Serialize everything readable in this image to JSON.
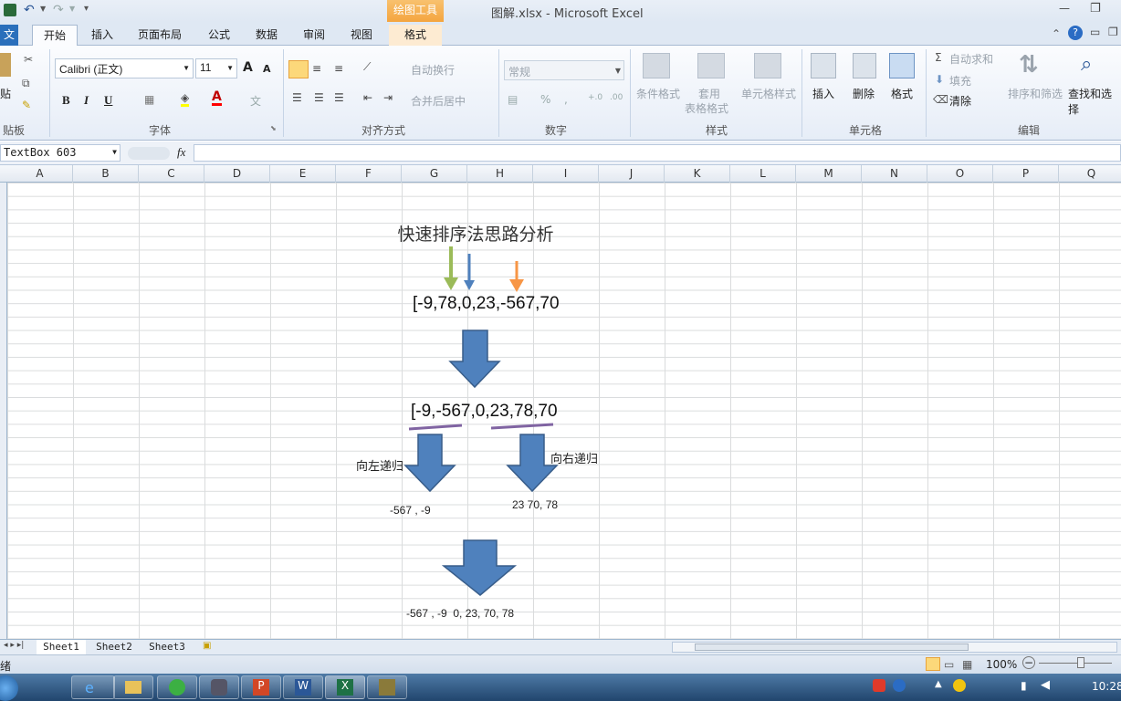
{
  "window": {
    "title": "图解.xlsx  -  Microsoft Excel",
    "context_tab_group": "绘图工具",
    "minimize": "—",
    "restore": "❐",
    "close": "✕"
  },
  "tabs": [
    "文件",
    "开始",
    "插入",
    "页面布局",
    "公式",
    "数据",
    "审阅",
    "视图",
    "格式"
  ],
  "ribbon": {
    "clipboard": {
      "label": "贴板",
      "paste": "贴"
    },
    "font": {
      "name": "Calibri (正文)",
      "size": "11",
      "label": "字体",
      "bold": "B",
      "italic": "I",
      "underline": "U",
      "grow": "A",
      "shrink": "A"
    },
    "align": {
      "wrap": "自动换行",
      "merge": "合并后居中",
      "label": "对齐方式"
    },
    "number": {
      "format": "常规",
      "percent": "%",
      "comma": ",",
      "label": "数字",
      "inc": "+.0\n.00",
      "dec": ".00\n+.0"
    },
    "styles": {
      "cond": "条件格式",
      "table": "套用",
      "table2": "表格格式",
      "cell": "单元格样式",
      "label": "样式"
    },
    "cells": {
      "insert": "插入",
      "delete": "删除",
      "format": "格式",
      "label": "单元格"
    },
    "editing": {
      "autosum": "自动求和",
      "fill": "填充",
      "clear": "清除",
      "sort": "排序和筛选",
      "find": "查找和选择",
      "label": "编辑",
      "sigma": "Σ"
    }
  },
  "formula_bar": {
    "name_box": "TextBox 603",
    "fx": "fx",
    "value": ""
  },
  "columns": [
    "A",
    "B",
    "C",
    "D",
    "E",
    "F",
    "G",
    "H",
    "I",
    "J",
    "K",
    "L",
    "M",
    "N",
    "O",
    "P",
    "Q"
  ],
  "drawing": {
    "title": "快速排序法思路分析",
    "array1": "[-9,78,0,23,-567,70",
    "array2": "[-9,-567,0,23,78,70",
    "left_label": "向左递归",
    "right_label": "向右递归",
    "left_result": "-567 , -9",
    "right_result": "23 70, 78",
    "final_result": "-567 , -9  0, 23, 70, 78",
    "colors": {
      "arrow_blue": "#4f81bd",
      "arrow_green": "#9bbb59",
      "arrow_orange": "#f79646",
      "underline_purple": "#8064a2"
    }
  },
  "sheets": [
    "Sheet1",
    "Sheet2",
    "Sheet3"
  ],
  "status": {
    "mode": "绪",
    "zoom": "100%",
    "minus": "−",
    "plus": "+"
  },
  "taskbar": {
    "time": "10:28"
  }
}
